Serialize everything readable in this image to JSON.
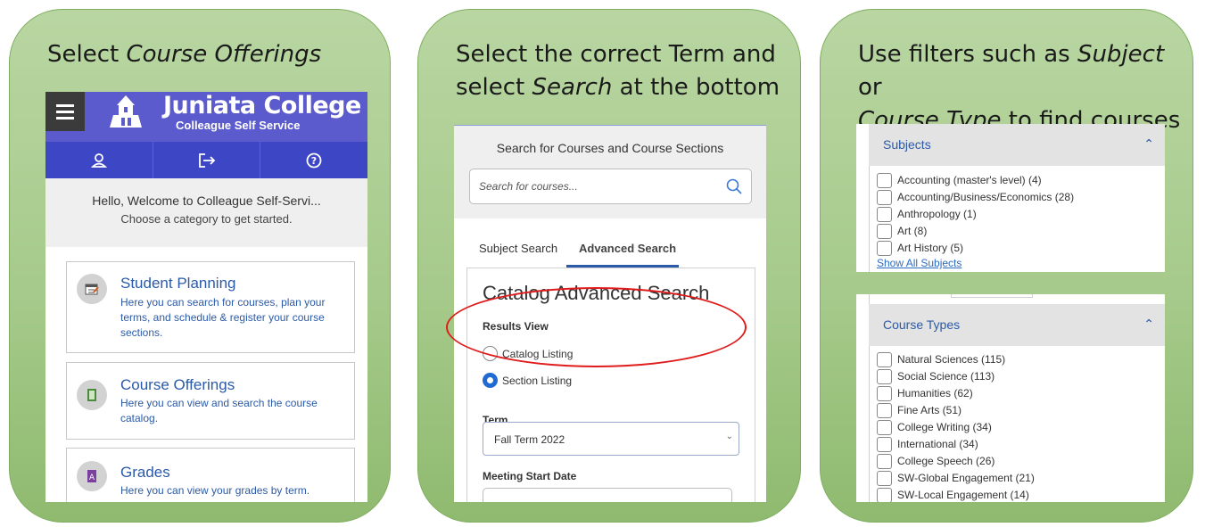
{
  "panel1": {
    "title_prefix": "Select ",
    "title_em": "Course Offerings",
    "brand_title": "Juniata College",
    "brand_subtitle": "Colleague Self Service",
    "icon_user": "user-icon",
    "icon_signout": "sign-out-icon",
    "icon_help": "help-icon",
    "welcome_line1": "Hello, Welcome to Colleague Self-Servi...",
    "welcome_line2": "Choose a category to get started.",
    "items": [
      {
        "title": "Student Planning",
        "desc": "Here you can search for courses, plan your terms, and schedule & register your course sections."
      },
      {
        "title": "Course Offerings",
        "desc": "Here you can view and search the course catalog."
      },
      {
        "title": "Grades",
        "desc": "Here you can view your grades by term."
      }
    ]
  },
  "panel2": {
    "title_line1": "Select the correct Term and",
    "title_line2_prefix": "select ",
    "title_line2_em": "Search",
    "title_line2_suffix": " at the bottom",
    "search_heading": "Search for Courses and Course Sections",
    "search_placeholder": "Search for courses...",
    "tabs": [
      "Subject Search",
      "Advanced Search"
    ],
    "panel_heading": "Catalog Advanced Search",
    "results_view_label": "Results View",
    "radio_options": [
      {
        "label": "Catalog Listing",
        "selected": false
      },
      {
        "label": "Section Listing",
        "selected": true
      }
    ],
    "term_label": "Term",
    "term_value": "Fall Term 2022",
    "meeting_start_label": "Meeting Start Date",
    "highlight_color": "#e01b1b"
  },
  "panel3": {
    "title_line1_prefix": "Use filters such as ",
    "title_line1_em": "Subject",
    "title_line1_suffix": " or",
    "title_line2_em": "Course Type",
    "title_line2_suffix": " to find courses",
    "subjects_header": "Subjects",
    "subjects": [
      "Accounting (master's level) (4)",
      "Accounting/Business/Economics (28)",
      "Anthropology (1)",
      "Art (8)",
      "Art History (5)"
    ],
    "show_all_link": "Show All Subjects",
    "course_types_header": "Course Types",
    "course_types": [
      "Natural Sciences (115)",
      "Social Science (113)",
      "Humanities (62)",
      "Fine Arts (51)",
      "College Writing (34)",
      "International (34)",
      "College Speech (26)",
      "SW-Global Engagement (21)",
      "SW-Local Engagement (14)"
    ]
  },
  "colors": {
    "card_green": "#a6ca8b",
    "card_border": "#7fae5f",
    "header_purple": "#5b5bcd",
    "link_blue": "#2b5aa8"
  }
}
